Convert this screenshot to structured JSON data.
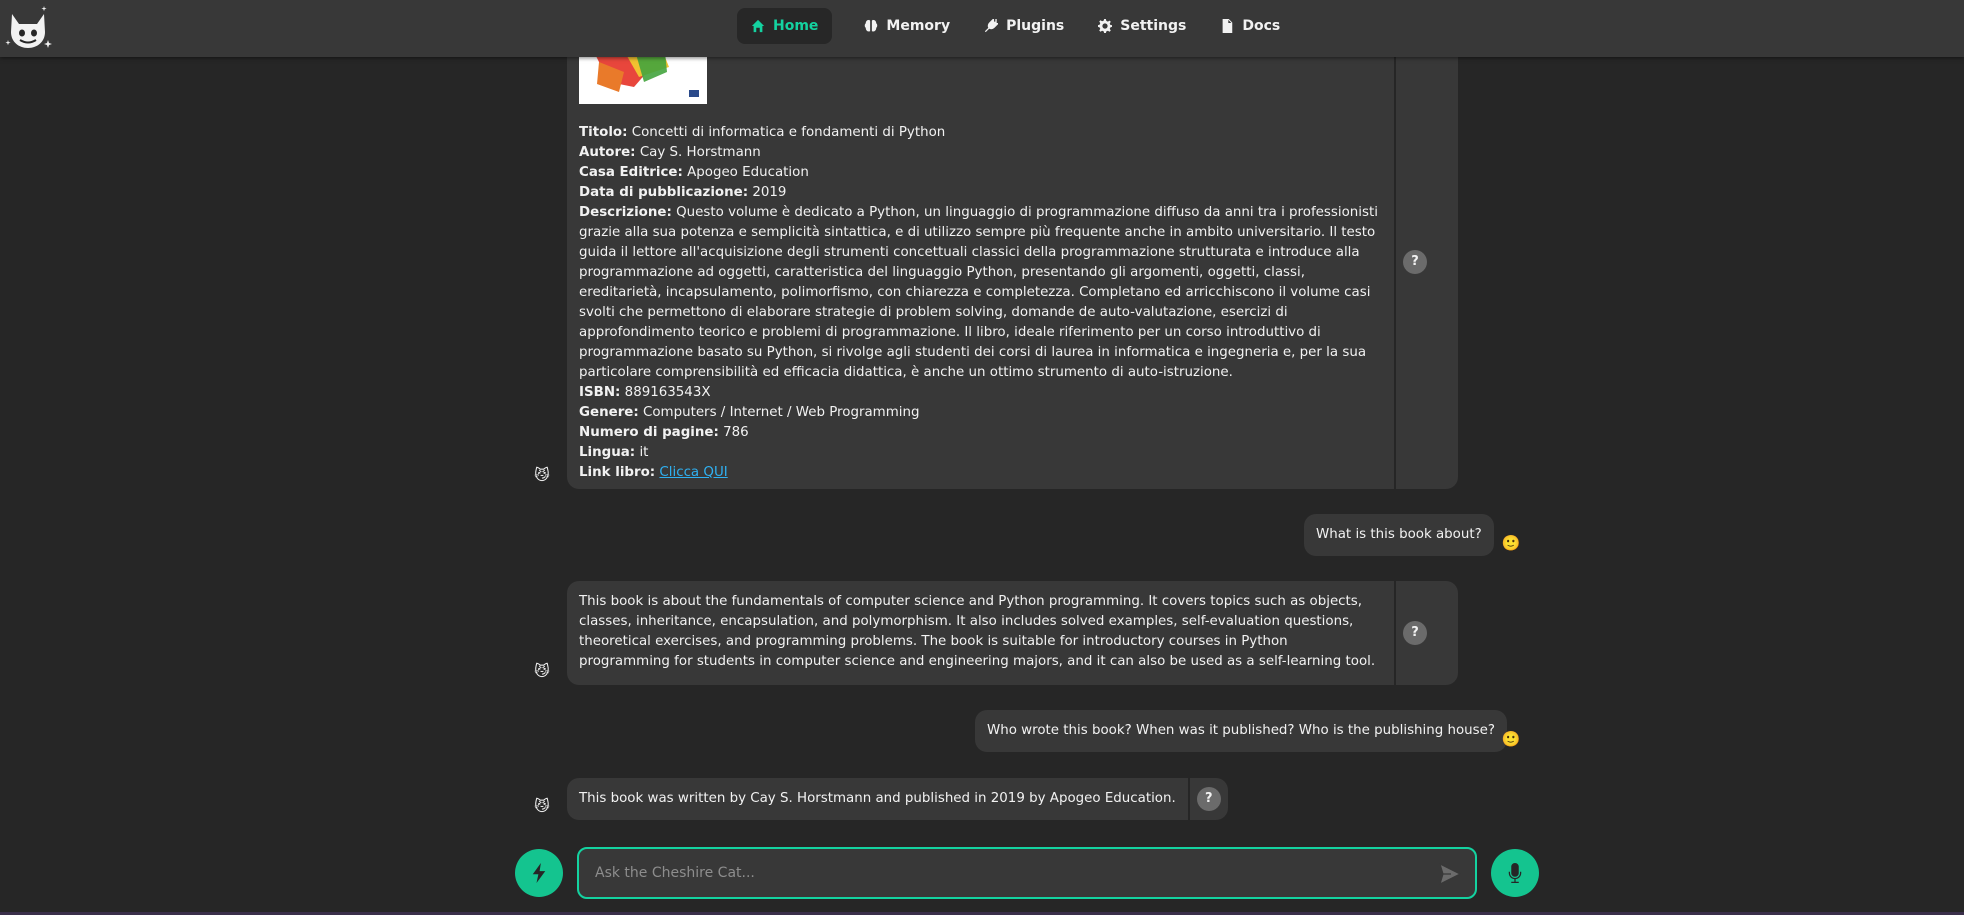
{
  "header": {
    "nav": [
      {
        "label": "Home",
        "icon": "home-icon",
        "active": true
      },
      {
        "label": "Memory",
        "icon": "brain-icon"
      },
      {
        "label": "Plugins",
        "icon": "plug-icon"
      },
      {
        "label": "Settings",
        "icon": "gear-icon"
      },
      {
        "label": "Docs",
        "icon": "document-icon"
      }
    ]
  },
  "book": {
    "title_label": "Titolo:",
    "title": "Concetti di informatica e fondamenti di Python",
    "author_label": "Autore:",
    "author": "Cay S. Horstmann",
    "publisher_label": "Casa Editrice:",
    "publisher": "Apogeo Education",
    "date_label": "Data di pubblicazione:",
    "date": "2019",
    "description_label": "Descrizione:",
    "description": "Questo volume è dedicato a Python, un linguaggio di programmazione diffuso da anni tra i professionisti grazie alla sua potenza e semplicità sintattica, e di utilizzo sempre più frequente anche in ambito universitario. Il testo guida il lettore all'acquisizione degli strumenti concettuali classici della programmazione strutturata e introduce alla programmazione ad oggetti, caratteristica del linguaggio Python, presentando gli argomenti, oggetti, classi, ereditarietà, incapsulamento, polimorfismo, con chiarezza e completezza. Completano ed arricchiscono il volume casi svolti che permettono di elaborare strategie di problem solving, domande de auto-valutazione, esercizi di approfondimento teorico e problemi di programmazione. Il libro, ideale riferimento per un corso introduttivo di programmazione basato su Python, si rivolge agli studenti dei corsi di laurea in informatica e ingegneria e, per la sua particolare comprensibilità ed efficacia didattica, è anche un ottimo strumento di auto-istruzione.",
    "isbn_label": "ISBN:",
    "isbn": "889163543X",
    "genre_label": "Genere:",
    "genre": "Computers / Internet / Web Programming",
    "pages_label": "Numero di pagine:",
    "pages": "786",
    "language_label": "Lingua:",
    "language": "it",
    "link_label": "Link libro:",
    "link_text": "Clicca QUI"
  },
  "messages": {
    "user1": "What is this book about?",
    "bot2": "This book is about the fundamentals of computer science and Python programming. It covers topics such as objects, classes, inheritance, encapsulation, and polymorphism. It also includes solved examples, self-evaluation questions, theoretical exercises, and programming problems. The book is suitable for introductory courses in Python programming for students in computer science and engineering majors, and it can also be used as a self-learning tool.",
    "user2": "Who wrote this book? When was it published? Who is the publishing house?",
    "bot3": "This book was written by Cay S. Horstmann and published in 2019 by Apogeo Education.",
    "why_label": "?"
  },
  "input": {
    "placeholder": "Ask the Cheshire Cat..."
  },
  "colors": {
    "accent": "#14d2a0",
    "background": "#262626",
    "bubble": "#383838",
    "link": "#2fb1f2"
  },
  "avatars": {
    "bot": "😼",
    "user": "🙂"
  }
}
